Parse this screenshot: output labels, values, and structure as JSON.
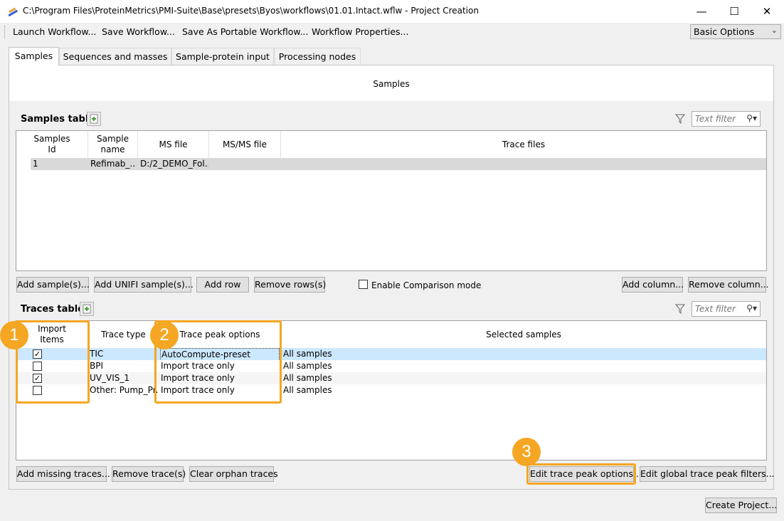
{
  "window": {
    "title": "C:\\Program Files\\ProteinMetrics\\PMI-Suite\\Base\\presets\\Byos\\workflows\\01.01.Intact.wflw - Project Creation",
    "minimize": "—",
    "maximize": "☐",
    "close": "✕"
  },
  "menu": {
    "items": [
      "Launch Workflow...",
      "Save Workflow...",
      "Save As Portable Workflow...",
      "Workflow Properties..."
    ],
    "options_select": "Basic Options"
  },
  "tabs": [
    "Samples",
    "Sequences and masses",
    "Sample-protein input",
    "Processing nodes"
  ],
  "samples_section": {
    "header": "Samples",
    "table_label": "Samples table",
    "filter_placeholder": "Text filter",
    "columns": [
      "Samples Id",
      "Sample name",
      "MS file",
      "MS/MS file",
      "Trace files"
    ],
    "rows": [
      {
        "id": "1",
        "name": "Refimab_...",
        "ms_file": "D:/2_DEMO_Fol...",
        "msms_file": "",
        "trace_files": ""
      }
    ],
    "buttons": {
      "add_samples": "Add sample(s)...",
      "add_unifi": "Add UNIFI sample(s)...",
      "add_row": "Add row",
      "remove_rows": "Remove rows(s)",
      "comparison_mode": "Enable Comparison mode",
      "add_column": "Add column...",
      "remove_column": "Remove column..."
    }
  },
  "traces_section": {
    "table_label": "Traces table",
    "filter_placeholder": "Text filter",
    "columns": [
      "Import Items",
      "Trace type",
      "Trace peak options",
      "Selected samples"
    ],
    "rows": [
      {
        "checked": true,
        "type": "TIC",
        "peak_option": "AutoCompute-preset",
        "samples": "All samples"
      },
      {
        "checked": false,
        "type": "BPI",
        "peak_option": "Import trace only",
        "samples": "All samples"
      },
      {
        "checked": true,
        "type": "UV_VIS_1",
        "peak_option": "Import trace only",
        "samples": "All samples"
      },
      {
        "checked": false,
        "type": "Other: Pump_Pr...",
        "peak_option": "Import trace only",
        "samples": "All samples"
      }
    ],
    "buttons": {
      "add_missing": "Add missing traces...",
      "remove_trace": "Remove trace(s)",
      "clear_orphan": "Clear orphan traces",
      "edit_peak_options": "Edit trace peak options...",
      "edit_global_filters": "Edit global trace peak filters..."
    }
  },
  "callouts": [
    "1",
    "2",
    "3"
  ],
  "footer": {
    "create_project": "Create Project..."
  },
  "colors": {
    "accent": "#f5a623",
    "selection": "#cce8ff"
  }
}
